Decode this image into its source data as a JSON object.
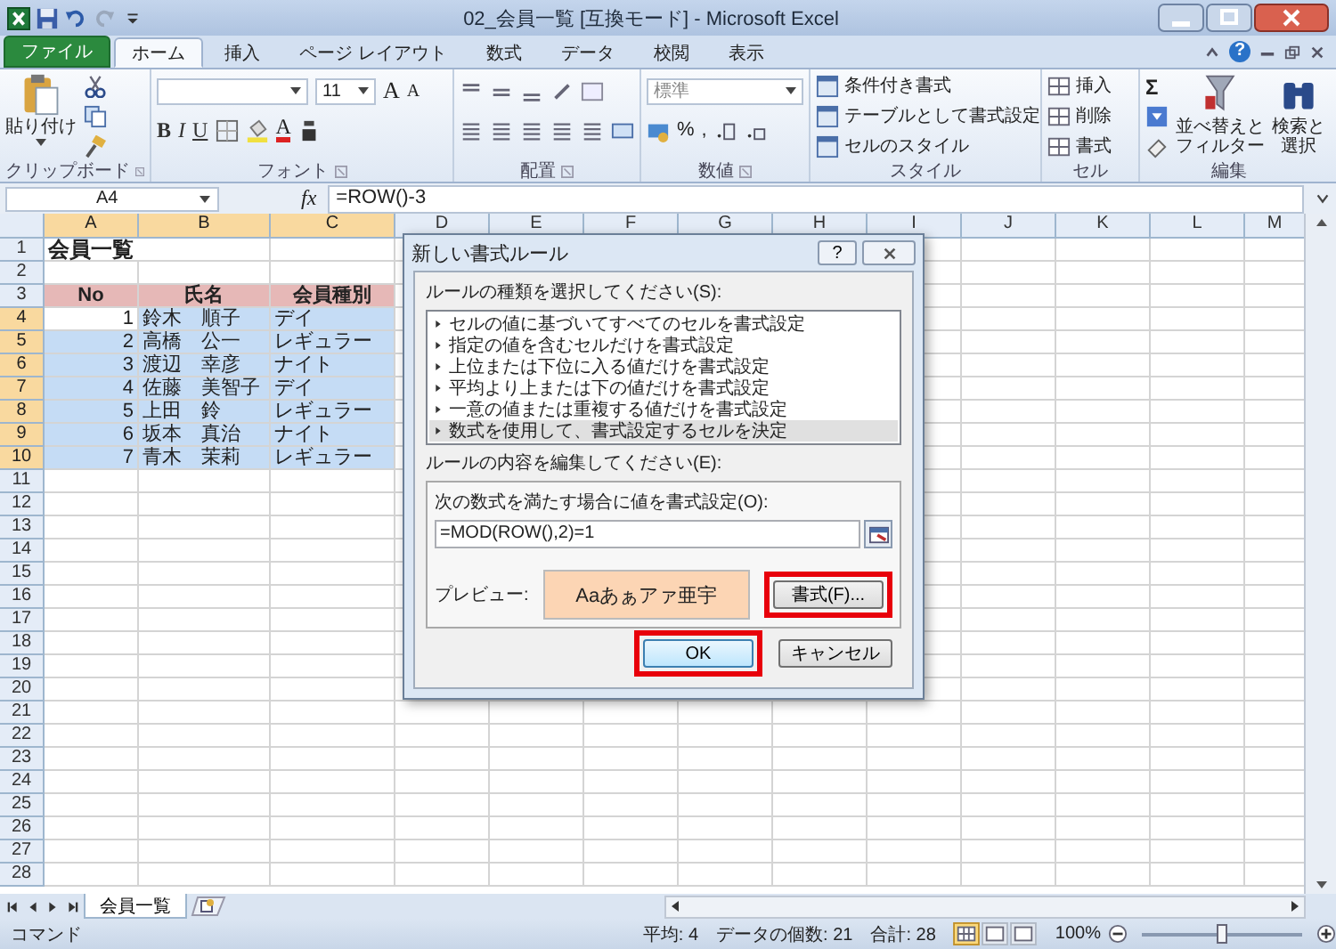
{
  "window": {
    "title": "02_会員一覧 [互換モード] - Microsoft Excel",
    "help": "?"
  },
  "ribbon_tabs": [
    {
      "label": "ファイル",
      "kind": "file",
      "selected": false
    },
    {
      "label": "ホーム",
      "kind": "tab",
      "selected": true
    },
    {
      "label": "挿入",
      "kind": "tab",
      "selected": false
    },
    {
      "label": "ページ レイアウト",
      "kind": "tab",
      "selected": false
    },
    {
      "label": "数式",
      "kind": "tab",
      "selected": false
    },
    {
      "label": "データ",
      "kind": "tab",
      "selected": false
    },
    {
      "label": "校閲",
      "kind": "tab",
      "selected": false
    },
    {
      "label": "表示",
      "kind": "tab",
      "selected": false
    }
  ],
  "ribbon": {
    "clipboard": {
      "paste": "貼り付け",
      "label": "クリップボード"
    },
    "font": {
      "font_size": "11",
      "grow": "A",
      "shrink": "A",
      "buttons": [
        "B",
        "I",
        "U"
      ],
      "font_color": "A",
      "label": "フォント"
    },
    "alignment": {
      "label": "配置"
    },
    "number": {
      "format": "標準",
      "percent": "%",
      "comma": ",",
      "label": "数値"
    },
    "styles": {
      "items": [
        "条件付き書式",
        "テーブルとして書式設定",
        "セルのスタイル"
      ],
      "label": "スタイル"
    },
    "cells": {
      "items": [
        "挿入",
        "削除",
        "書式"
      ],
      "label": "セル"
    },
    "editing": {
      "sum": "Σ",
      "sort": [
        "並べ替えと",
        "フィルター"
      ],
      "find": [
        "検索と",
        "選択"
      ],
      "label": "編集"
    }
  },
  "formula_bar": {
    "name_box": "A4",
    "function_label": "fx",
    "formula": "=ROW()-3"
  },
  "sheet": {
    "columns": [
      {
        "label": "A",
        "selected": true
      },
      {
        "label": "B",
        "selected": true
      },
      {
        "label": "C",
        "selected": true
      },
      {
        "label": "D",
        "selected": false
      },
      {
        "label": "E",
        "selected": false
      },
      {
        "label": "F",
        "selected": false
      },
      {
        "label": "G",
        "selected": false
      },
      {
        "label": "H",
        "selected": false
      },
      {
        "label": "I",
        "selected": false
      },
      {
        "label": "J",
        "selected": false
      },
      {
        "label": "K",
        "selected": false
      },
      {
        "label": "L",
        "selected": false
      },
      {
        "label": "M",
        "selected": false
      }
    ],
    "rows": [
      {
        "number": "1",
        "kind": "title",
        "cells": [
          "会員一覧"
        ],
        "selected": false
      },
      {
        "number": "2",
        "kind": "empty",
        "selected": false
      },
      {
        "number": "3",
        "kind": "header",
        "cells": [
          "No",
          "氏名",
          "会員種別"
        ],
        "selected": false
      },
      {
        "number": "4",
        "kind": "data",
        "cells": [
          "1",
          "鈴木　順子",
          "デイ"
        ],
        "selected": true
      },
      {
        "number": "5",
        "kind": "data",
        "cells": [
          "2",
          "高橋　公一",
          "レギュラー"
        ],
        "selected": true
      },
      {
        "number": "6",
        "kind": "data",
        "cells": [
          "3",
          "渡辺　幸彦",
          "ナイト"
        ],
        "selected": true
      },
      {
        "number": "7",
        "kind": "data",
        "cells": [
          "4",
          "佐藤　美智子",
          "デイ"
        ],
        "selected": true
      },
      {
        "number": "8",
        "kind": "data",
        "cells": [
          "5",
          "上田　鈴",
          "レギュラー"
        ],
        "selected": true
      },
      {
        "number": "9",
        "kind": "data",
        "cells": [
          "6",
          "坂本　真治",
          "ナイト"
        ],
        "selected": true
      },
      {
        "number": "10",
        "kind": "data",
        "cells": [
          "7",
          "青木　茉莉",
          "レギュラー"
        ],
        "selected": true
      },
      {
        "number": "11",
        "kind": "empty",
        "selected": false
      },
      {
        "number": "12",
        "kind": "empty",
        "selected": false
      },
      {
        "number": "13",
        "kind": "empty",
        "selected": false
      },
      {
        "number": "14",
        "kind": "empty",
        "selected": false
      },
      {
        "number": "15",
        "kind": "empty",
        "selected": false
      },
      {
        "number": "16",
        "kind": "empty",
        "selected": false
      },
      {
        "number": "17",
        "kind": "empty",
        "selected": false
      },
      {
        "number": "18",
        "kind": "empty",
        "selected": false
      },
      {
        "number": "19",
        "kind": "empty",
        "selected": false
      },
      {
        "number": "20",
        "kind": "empty",
        "selected": false
      },
      {
        "number": "21",
        "kind": "empty",
        "selected": false
      },
      {
        "number": "22",
        "kind": "empty",
        "selected": false
      },
      {
        "number": "23",
        "kind": "empty",
        "selected": false
      },
      {
        "number": "24",
        "kind": "empty",
        "selected": false
      },
      {
        "number": "25",
        "kind": "empty",
        "selected": false
      },
      {
        "number": "26",
        "kind": "empty",
        "selected": false
      },
      {
        "number": "27",
        "kind": "empty",
        "selected": false
      },
      {
        "number": "28",
        "kind": "empty",
        "selected": false
      }
    ]
  },
  "dialog": {
    "title": "新しい書式ルール",
    "help": "?",
    "rule_type_label": "ルールの種類を選択してください(S):",
    "rule_types": [
      {
        "label": "セルの値に基づいてすべてのセルを書式設定",
        "selected": false
      },
      {
        "label": "指定の値を含むセルだけを書式設定",
        "selected": false
      },
      {
        "label": "上位または下位に入る値だけを書式設定",
        "selected": false
      },
      {
        "label": "平均より上または下の値だけを書式設定",
        "selected": false
      },
      {
        "label": "一意の値または重複する値だけを書式設定",
        "selected": false
      },
      {
        "label": "数式を使用して、書式設定するセルを決定",
        "selected": true
      }
    ],
    "edit_label": "ルールの内容を編集してください(E):",
    "formula_label": "次の数式を満たす場合に値を書式設定(O):",
    "formula": "=MOD(ROW(),2)=1",
    "preview_label": "プレビュー:",
    "preview": "Aaあぁアァ亜宇",
    "buttons": [
      {
        "label": "書式(F)...",
        "kind": "format",
        "highlighted": true
      },
      {
        "label": "OK",
        "kind": "ok",
        "highlighted": true
      },
      {
        "label": "キャンセル",
        "kind": "cancel",
        "highlighted": false
      }
    ]
  },
  "sheet_tabs": [
    {
      "label": "会員一覧",
      "selected": true
    }
  ],
  "status_bar": {
    "mode": "コマンド",
    "average": "平均: 4",
    "count": "データの個数: 21",
    "sum": "合計: 28",
    "view_buttons": [
      {
        "selected": true
      },
      {
        "selected": false
      },
      {
        "selected": false
      }
    ],
    "zoom": "100%",
    "zoom_slider": {
      "level": 0.5
    }
  }
}
